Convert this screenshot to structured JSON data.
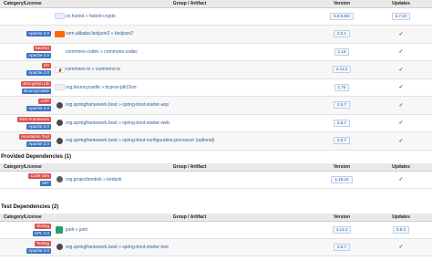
{
  "main_deps": {
    "headers": [
      "Category/License",
      "Group / Artifact",
      "Version",
      "Updates"
    ],
    "rows": [
      {
        "badges": [],
        "logo": "hutool-logo",
        "artifact": "cn.hutool » hutool-crypto",
        "version": "5.8.0.M3",
        "update": "5.7.22"
      },
      {
        "badges": [
          {
            "text": "Apache 2.0",
            "color": "blue"
          }
        ],
        "logo": "alibaba-logo",
        "artifact": "com.alibaba.fastjson2 » fastjson2",
        "version": "2.0.1",
        "update": "✓"
      },
      {
        "badges": [
          {
            "text": "Base64",
            "color": "red"
          },
          {
            "text": "Apache 2.0",
            "color": "blue"
          }
        ],
        "logo": "blank-logo",
        "artifact": "commons-codec » commons-codec",
        "version": "1.15",
        "update": "✓"
      },
      {
        "badges": [
          {
            "text": "I/O",
            "color": "red"
          },
          {
            "text": "Apache 2.0",
            "color": "blue"
          }
        ],
        "logo": "java-logo",
        "artifact": "commons-io » commons-io",
        "version": "2.11.0",
        "update": "✓"
      },
      {
        "badges": [
          {
            "text": "Encryption Lib",
            "color": "red"
          },
          {
            "text": "BouncyCastle",
            "color": "blue"
          }
        ],
        "logo": "bc-logo",
        "artifact": "org.bouncycastle » bcprov-jdk15on",
        "version": "1.70",
        "update": "✓"
      },
      {
        "badges": [
          {
            "text": "AOP",
            "color": "red"
          },
          {
            "text": "Apache 2.0",
            "color": "blue"
          }
        ],
        "logo": "spring-logo",
        "artifact": "org.springframework.boot » spring-boot-starter-aop",
        "version": "2.6.7",
        "update": "✓"
      },
      {
        "badges": [
          {
            "text": "Web Framework",
            "color": "red"
          },
          {
            "text": "Apache 2.0",
            "color": "blue"
          }
        ],
        "logo": "spring-logo",
        "artifact": "org.springframework.boot » spring-boot-starter-web",
        "version": "2.6.7",
        "update": "✓"
      },
      {
        "badges": [
          {
            "text": "Annotation Tool",
            "color": "red"
          },
          {
            "text": "Apache 2.0",
            "color": "blue"
          }
        ],
        "logo": "spring-logo",
        "artifact": "org.springframework.boot » spring-boot-configuration-processor (optional)",
        "version": "2.6.7",
        "update": "✓"
      }
    ]
  },
  "provided": {
    "title": "Provided Dependencies (1)",
    "headers": [
      "Category/License",
      "Group / Artifact",
      "Version",
      "Updates"
    ],
    "rows": [
      {
        "badges": [
          {
            "text": "Code Gen",
            "color": "red"
          },
          {
            "text": "MIT",
            "color": "blue"
          }
        ],
        "logo": "lombok-logo",
        "artifact": "org.projectlombok » lombok",
        "version": "1.18.24",
        "update": "✓"
      }
    ]
  },
  "test": {
    "title": "Test Dependencies (2)",
    "headers": [
      "Category/License",
      "Group / Artifact",
      "Version",
      "Updates"
    ],
    "rows": [
      {
        "badges": [
          {
            "text": "Testing",
            "color": "red"
          },
          {
            "text": "EPL 2.0",
            "color": "blue"
          }
        ],
        "logo": "junit-logo",
        "artifact": "junit » junit",
        "version": "4.13.2",
        "update": "5.8.2"
      },
      {
        "badges": [
          {
            "text": "Testing",
            "color": "red"
          },
          {
            "text": "Apache 2.0",
            "color": "blue"
          }
        ],
        "logo": "spring-logo",
        "artifact": "org.springframework.boot » spring-boot-starter-test",
        "version": "2.6.7",
        "update": "✓"
      }
    ]
  }
}
